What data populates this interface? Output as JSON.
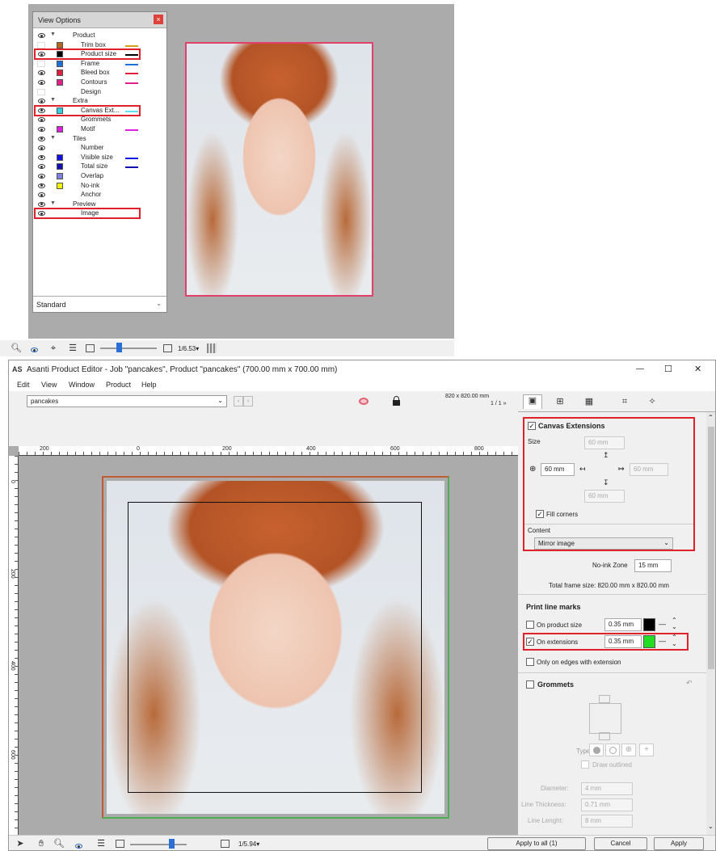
{
  "view_options": {
    "title": "View Options",
    "close": "×",
    "items": [
      {
        "label": "Product",
        "indent": 1,
        "eye": true,
        "group": true,
        "swatch": null,
        "line": null
      },
      {
        "label": "Trim box",
        "indent": 2,
        "eye": false,
        "group": false,
        "swatch": "#b5651d",
        "line": "#d4a017"
      },
      {
        "label": "Product size",
        "indent": 2,
        "eye": true,
        "group": false,
        "swatch": "#000000",
        "line": "#000000",
        "hl": true
      },
      {
        "label": "Frame",
        "indent": 2,
        "eye": false,
        "group": false,
        "swatch": "#1e6fd9",
        "line": "#1e6fd9"
      },
      {
        "label": "Bleed box",
        "indent": 2,
        "eye": true,
        "group": false,
        "swatch": "#e02040",
        "line": "#e02040"
      },
      {
        "label": "Contours",
        "indent": 2,
        "eye": true,
        "group": false,
        "swatch": "#e0208a",
        "line": "#e0208a"
      },
      {
        "label": "Design",
        "indent": 2,
        "eye": false,
        "group": false,
        "swatch": null,
        "line": null
      },
      {
        "label": "Extra",
        "indent": 1,
        "eye": true,
        "group": true,
        "swatch": null,
        "line": null
      },
      {
        "label": "Canvas Ext...",
        "indent": 2,
        "eye": true,
        "group": false,
        "swatch": "#30d0e0",
        "line": "#60e0f0",
        "hl": true
      },
      {
        "label": "Grommets",
        "indent": 2,
        "eye": true,
        "group": false,
        "swatch": null,
        "line": null
      },
      {
        "label": "Motif",
        "indent": 2,
        "eye": true,
        "group": false,
        "swatch": "#e020e0",
        "line": "#e020e0"
      },
      {
        "label": "Tiles",
        "indent": 1,
        "eye": true,
        "group": true,
        "swatch": null,
        "line": null
      },
      {
        "label": "Number",
        "indent": 2,
        "eye": true,
        "group": false,
        "swatch": null,
        "line": null
      },
      {
        "label": "Visible size",
        "indent": 2,
        "eye": true,
        "group": false,
        "swatch": "#1010e0",
        "line": "#1010e0"
      },
      {
        "label": "Total size",
        "indent": 2,
        "eye": true,
        "group": false,
        "swatch": "#1010b0",
        "line": "#1010b0"
      },
      {
        "label": "Overlap",
        "indent": 2,
        "eye": true,
        "group": false,
        "swatch": "#8080e0",
        "line": null
      },
      {
        "label": "No-ink",
        "indent": 2,
        "eye": true,
        "group": false,
        "swatch": "#f0f000",
        "line": null
      },
      {
        "label": "Anchor",
        "indent": 2,
        "eye": true,
        "group": false,
        "swatch": null,
        "line": null
      },
      {
        "label": "Preview",
        "indent": 1,
        "eye": true,
        "group": true,
        "swatch": null,
        "line": null
      },
      {
        "label": "Image",
        "indent": 2,
        "eye": true,
        "group": false,
        "swatch": null,
        "line": null,
        "hl": true
      }
    ],
    "preset": "Standard"
  },
  "top_toolbar": {
    "zoom": "1/6.53▾"
  },
  "window": {
    "app_icon": "AS",
    "title": "Asanti Product Editor - Job \"pancakes\", Product \"pancakes\" (700.00 mm x 700.00 mm)",
    "minimize": "—",
    "maximize": "☐",
    "close": "✕"
  },
  "menu": [
    "Edit",
    "View",
    "Window",
    "Product",
    "Help"
  ],
  "toolbar": {
    "product_select": "pancakes",
    "size_readout": "820 x 820.00 mm",
    "page_readout": "1 / 1 »"
  },
  "ruler": {
    "top": [
      "200",
      "0",
      "200",
      "400",
      "600",
      "800"
    ],
    "left": [
      "0",
      "200",
      "400",
      "600"
    ]
  },
  "panel": {
    "canvas_ext": {
      "title": "Canvas Extensions",
      "size_label": "Size",
      "top": "60 mm",
      "left": "60 mm",
      "right": "60 mm",
      "bottom": "60 mm",
      "fill_corners": "Fill corners",
      "content_label": "Content",
      "content_value": "Mirror image",
      "noink_label": "No-ink Zone",
      "noink_value": "15 mm"
    },
    "total_frame": "Total frame size:   820.00 mm x 820.00 mm",
    "print_marks": {
      "title": "Print line marks",
      "product_label": "On product size",
      "product_value": "0.35 mm",
      "ext_label": "On extensions",
      "ext_value": "0.35 mm",
      "edges_label": "Only on edges with extension"
    },
    "grommets": {
      "title": "Grommets",
      "type_label": "Type:",
      "draw_outlined": "Draw outlined",
      "diameter_label": "Diameter:",
      "diameter_value": "4 mm",
      "thickness_label": "Line Thickness:",
      "thickness_value": "0.71 mm",
      "length_label": "Line Lenght:",
      "length_value": "8 mm"
    }
  },
  "bottom": {
    "zoom": "1/5.94▾",
    "apply_all": "Apply to all (1)",
    "cancel": "Cancel",
    "apply": "Apply"
  },
  "colors": {
    "accent_red": "#e0202a",
    "ext_mark": "#22dd22"
  }
}
